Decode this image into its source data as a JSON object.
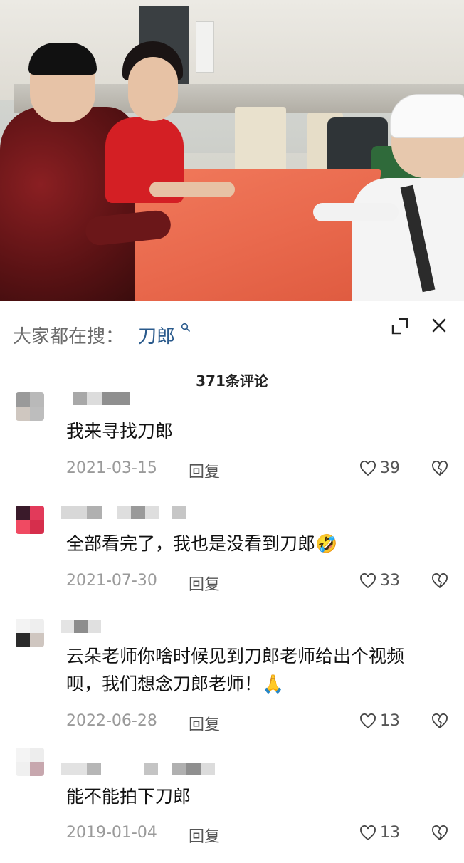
{
  "search": {
    "prefix": "大家都在搜：",
    "keyword": "刀郎"
  },
  "comments_count": "371条评论",
  "comments": [
    {
      "text": "我来寻找刀郎",
      "date": "2021-03-15",
      "reply_label": "回复",
      "likes": "39"
    },
    {
      "text": "全部看完了，我也是没看到刀郎🤣",
      "date": "2021-07-30",
      "reply_label": "回复",
      "likes": "33"
    },
    {
      "text": "云朵老师你啥时候见到刀郎老师给出个视频呗，我们想念刀郎老师！🙏",
      "date": "2022-06-28",
      "reply_label": "回复",
      "likes": "13"
    },
    {
      "text": "能不能拍下刀郎",
      "date": "2019-01-04",
      "reply_label": "回复",
      "likes": "13"
    }
  ],
  "colors": {
    "keyword": "#2a5a8c",
    "meta": "#9a9a9a",
    "table": "#ec6b4e"
  }
}
